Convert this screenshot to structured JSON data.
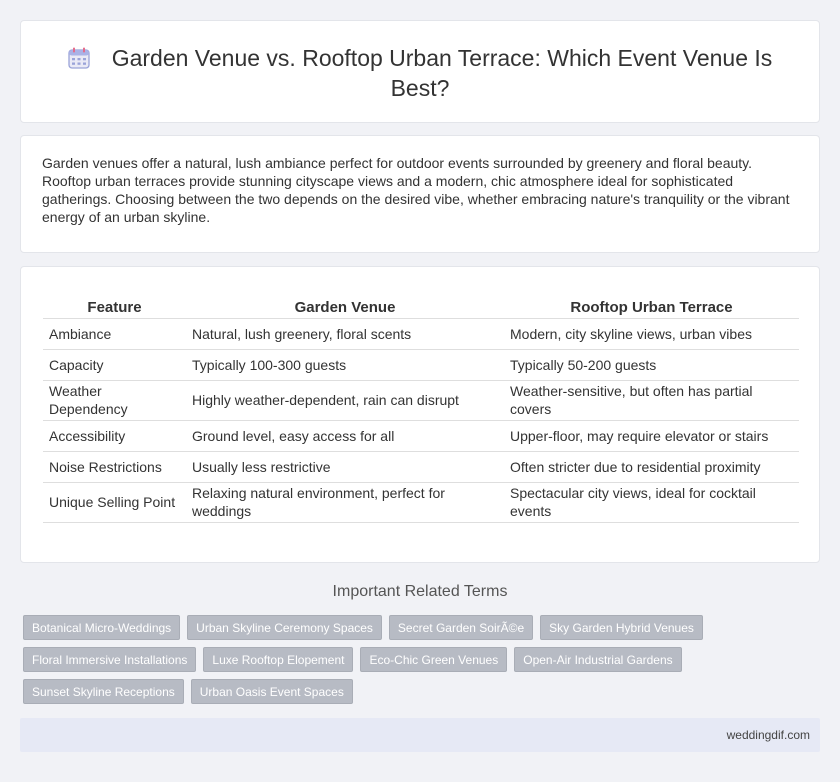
{
  "header": {
    "title": "Garden Venue vs. Rooftop Urban Terrace: Which Event Venue Is Best?",
    "icon": "calendar-icon"
  },
  "intro": {
    "text": "Garden venues offer a natural, lush ambiance perfect for outdoor events surrounded by greenery and floral beauty. Rooftop urban terraces provide stunning cityscape views and a modern, chic atmosphere ideal for sophisticated gatherings. Choosing between the two depends on the desired vibe, whether embracing nature's tranquility or the vibrant energy of an urban skyline."
  },
  "table": {
    "headers": [
      "Feature",
      "Garden Venue",
      "Rooftop Urban Terrace"
    ],
    "rows": [
      [
        "Ambiance",
        "Natural, lush greenery, floral scents",
        "Modern, city skyline views, urban vibes"
      ],
      [
        "Capacity",
        "Typically 100-300 guests",
        "Typically 50-200 guests"
      ],
      [
        "Weather Dependency",
        "Highly weather-dependent, rain can disrupt",
        "Weather-sensitive, but often has partial covers"
      ],
      [
        "Accessibility",
        "Ground level, easy access for all",
        "Upper-floor, may require elevator or stairs"
      ],
      [
        "Noise Restrictions",
        "Usually less restrictive",
        "Often stricter due to residential proximity"
      ],
      [
        "Unique Selling Point",
        "Relaxing natural environment, perfect for weddings",
        "Spectacular city views, ideal for cocktail events"
      ]
    ]
  },
  "related": {
    "title": "Important Related Terms",
    "tags": [
      "Botanical Micro-Weddings",
      "Urban Skyline Ceremony Spaces",
      "Secret Garden SoirÃ©e",
      "Sky Garden Hybrid Venues",
      "Floral Immersive Installations",
      "Luxe Rooftop Elopement",
      "Eco-Chic Green Venues",
      "Open-Air Industrial Gardens",
      "Sunset Skyline Receptions",
      "Urban Oasis Event Spaces"
    ]
  },
  "footer": {
    "text": "weddingdif.com"
  },
  "colors": {
    "background": "#f1f2f6",
    "tag": "#b7bbc4",
    "footer": "#e6e9f5"
  }
}
